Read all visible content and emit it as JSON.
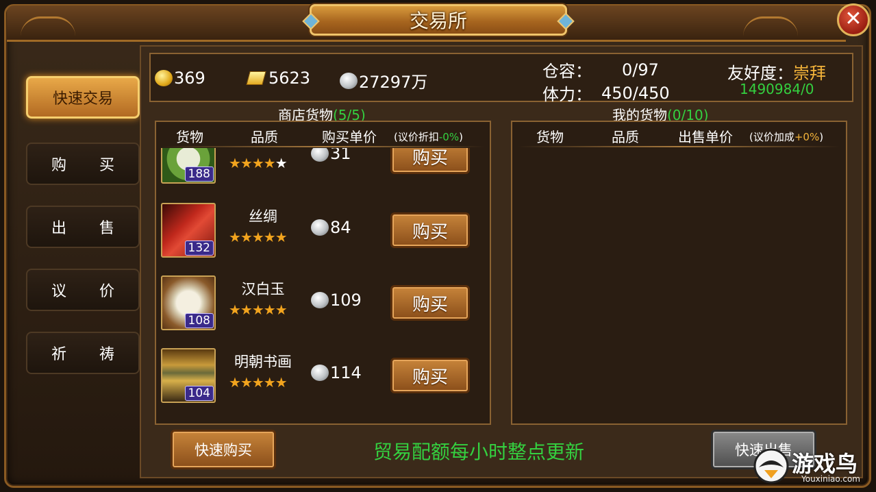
{
  "window": {
    "title": "交易所",
    "close_label": "✕"
  },
  "sidebar": {
    "items": [
      {
        "label": "快速交易",
        "active": true
      },
      {
        "label_a": "购",
        "label_b": "买"
      },
      {
        "label_a": "出",
        "label_b": "售"
      },
      {
        "label_a": "议",
        "label_b": "价"
      },
      {
        "label_a": "祈",
        "label_b": "祷"
      }
    ]
  },
  "stats": {
    "gold": "369",
    "ingot": "5623",
    "silver": "27297万",
    "capacity_label": "仓容：",
    "capacity_value": "0/97",
    "stamina_label": "体力：",
    "stamina_value": "450/450",
    "friendship_label": "友好度：",
    "friendship_level": "崇拜",
    "friendship_value": "1490984/0"
  },
  "shop": {
    "title": "商店货物",
    "count": "(5/5)",
    "headers": {
      "goods": "货物",
      "quality": "品质",
      "price": "购买单价",
      "discount_prefix": "(议价折扣",
      "discount_value": "-0%",
      "discount_suffix": ")"
    },
    "items": [
      {
        "name": "",
        "count": "188",
        "stars": "★★★★",
        "star_empty": "★",
        "price": "31",
        "button": "购买"
      },
      {
        "name": "丝绸",
        "count": "132",
        "stars": "★★★★★",
        "price": "84",
        "button": "购买"
      },
      {
        "name": "汉白玉",
        "count": "108",
        "stars": "★★★★★",
        "price": "109",
        "button": "购买"
      },
      {
        "name": "明朝书画",
        "count": "104",
        "stars": "★★★★★",
        "price": "114",
        "button": "购买"
      }
    ],
    "quick_buy": "快速购买"
  },
  "mine": {
    "title": "我的货物",
    "count": "(0/10)",
    "headers": {
      "goods": "货物",
      "quality": "品质",
      "price": "出售单价",
      "bonus_prefix": "(议价加成",
      "bonus_value": "+0%",
      "bonus_suffix": ")"
    },
    "quick_sell": "快速出售"
  },
  "notice": "贸易配额每小时整点更新",
  "watermark": {
    "text": "游戏鸟",
    "sub": "Youxiniao.com"
  },
  "colors": {
    "accent_gold": "#f3b33a",
    "accent_green": "#34d040",
    "frame": "#8a5a22"
  }
}
